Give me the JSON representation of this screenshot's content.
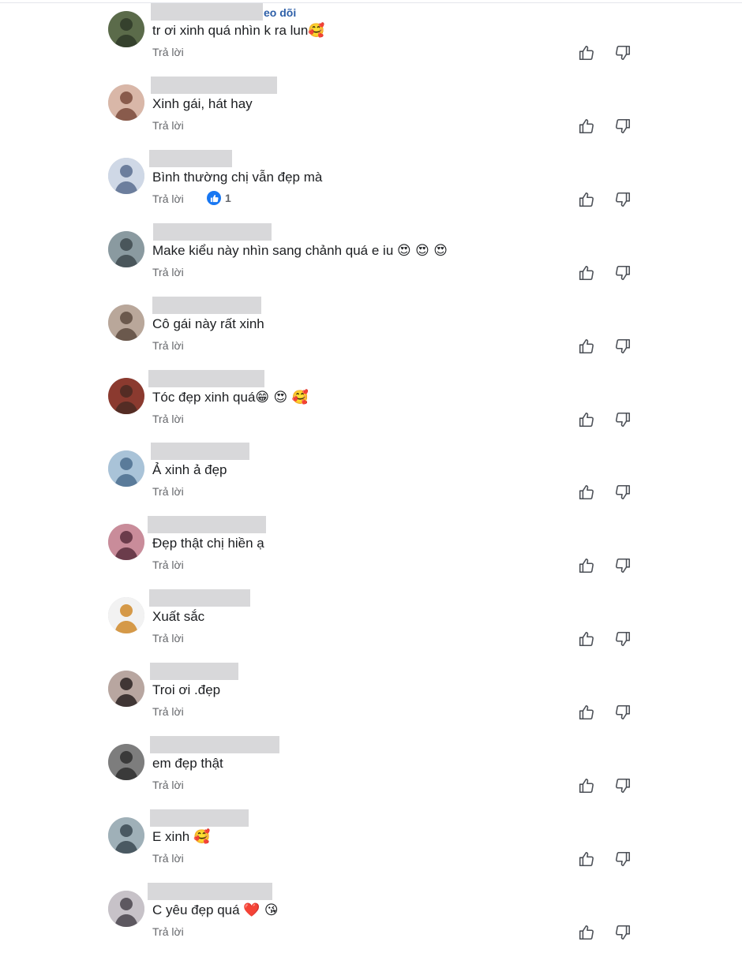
{
  "comments": [
    {
      "text": "tr ơi xinh quá nhìn k ra lun",
      "emoji": "🥰",
      "follow_fragment": "eo dõi",
      "reply_label": "Trả lời"
    },
    {
      "text": "Xinh gái, hát hay",
      "emoji": "",
      "reply_label": "Trả lời"
    },
    {
      "text": "Bình thường chị vẫn đẹp mà",
      "emoji": "",
      "reply_label": "Trả lời",
      "like_count": "1"
    },
    {
      "text": "Make kiểu này nhìn sang chảnh quá e iu ",
      "emoji": "😍 😍 😍",
      "reply_label": "Trả lời"
    },
    {
      "text": "Cô gái này rất xinh",
      "emoji": "",
      "reply_label": "Trả lời"
    },
    {
      "text": "Tóc đẹp xinh quá",
      "emoji": "😁 😍 🥰",
      "reply_label": "Trả lời"
    },
    {
      "text": "Ả xinh ả đẹp",
      "emoji": "",
      "reply_label": "Trả lời"
    },
    {
      "text": "Đẹp thật chị hiền ạ",
      "emoji": "",
      "reply_label": "Trả lời"
    },
    {
      "text": "Xuất sắc",
      "emoji": "",
      "reply_label": "Trả lời"
    },
    {
      "text": "Troi ơi .đẹp",
      "emoji": "",
      "reply_label": "Trả lời"
    },
    {
      "text": "em đẹp thật",
      "emoji": "",
      "reply_label": "Trả lời"
    },
    {
      "text": "E xinh ",
      "emoji": "🥰",
      "reply_label": "Trả lời"
    },
    {
      "text": "C yêu đẹp quá ",
      "emoji": "❤️ 😘",
      "reply_label": "Trả lời"
    }
  ],
  "colors": {
    "accent": "#1877f2",
    "follow": "#2d5fa8",
    "muted": "#65676b",
    "name_redaction": "#d8d8da"
  },
  "icons": {
    "like": "thumbs-up-icon",
    "dislike": "thumbs-down-icon",
    "reaction": "like-reaction-icon"
  }
}
